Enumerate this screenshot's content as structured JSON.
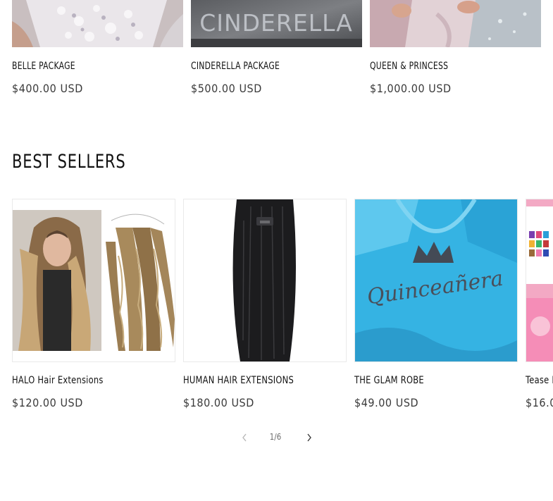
{
  "packages": [
    {
      "title": "BELLE PACKAGE",
      "price": "$400.00 USD"
    },
    {
      "title": "CINDERELLA PACKAGE",
      "price": "$500.00 USD",
      "image_text": "CINDERELLA"
    },
    {
      "title": "QUEEN & PRINCESS",
      "price": "$1,000.00 USD"
    }
  ],
  "best_sellers": {
    "heading": "BEST SELLERS",
    "products": [
      {
        "title": "HALO Hair Extensions",
        "price": "$120.00 USD"
      },
      {
        "title": "HUMAN HAIR EXTENSIONS",
        "price": "$180.00 USD"
      },
      {
        "title": "THE GLAM ROBE",
        "price": "$49.00 USD",
        "image_text": "Quinceañera"
      },
      {
        "title": "Tease I",
        "price": "$16.0"
      }
    ],
    "pagination": {
      "current": "1",
      "separator": "/",
      "total": "6",
      "label": "1/6"
    }
  },
  "icons": {
    "prev": "chevron-left-icon",
    "next": "chevron-right-icon"
  },
  "colors": {
    "text": "#121212",
    "price": "#3a3a3a",
    "robe": "#3fb7e6",
    "border": "#eaeaea"
  }
}
